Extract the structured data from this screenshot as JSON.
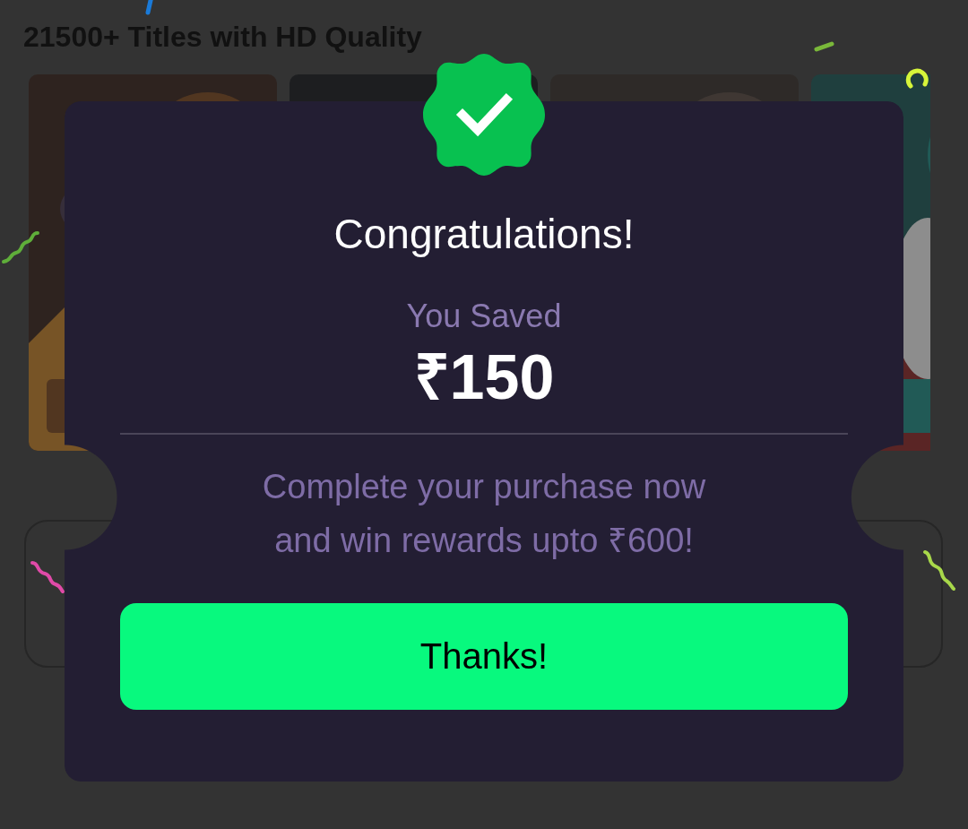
{
  "section": {
    "heading": "21500+ Titles with HD Quality"
  },
  "dialog": {
    "title": "Congratulations!",
    "subtitle": "You Saved",
    "amount": "₹150",
    "message": "Complete your purchase now\nand win rewards upto ₹600!",
    "button": "Thanks!"
  }
}
